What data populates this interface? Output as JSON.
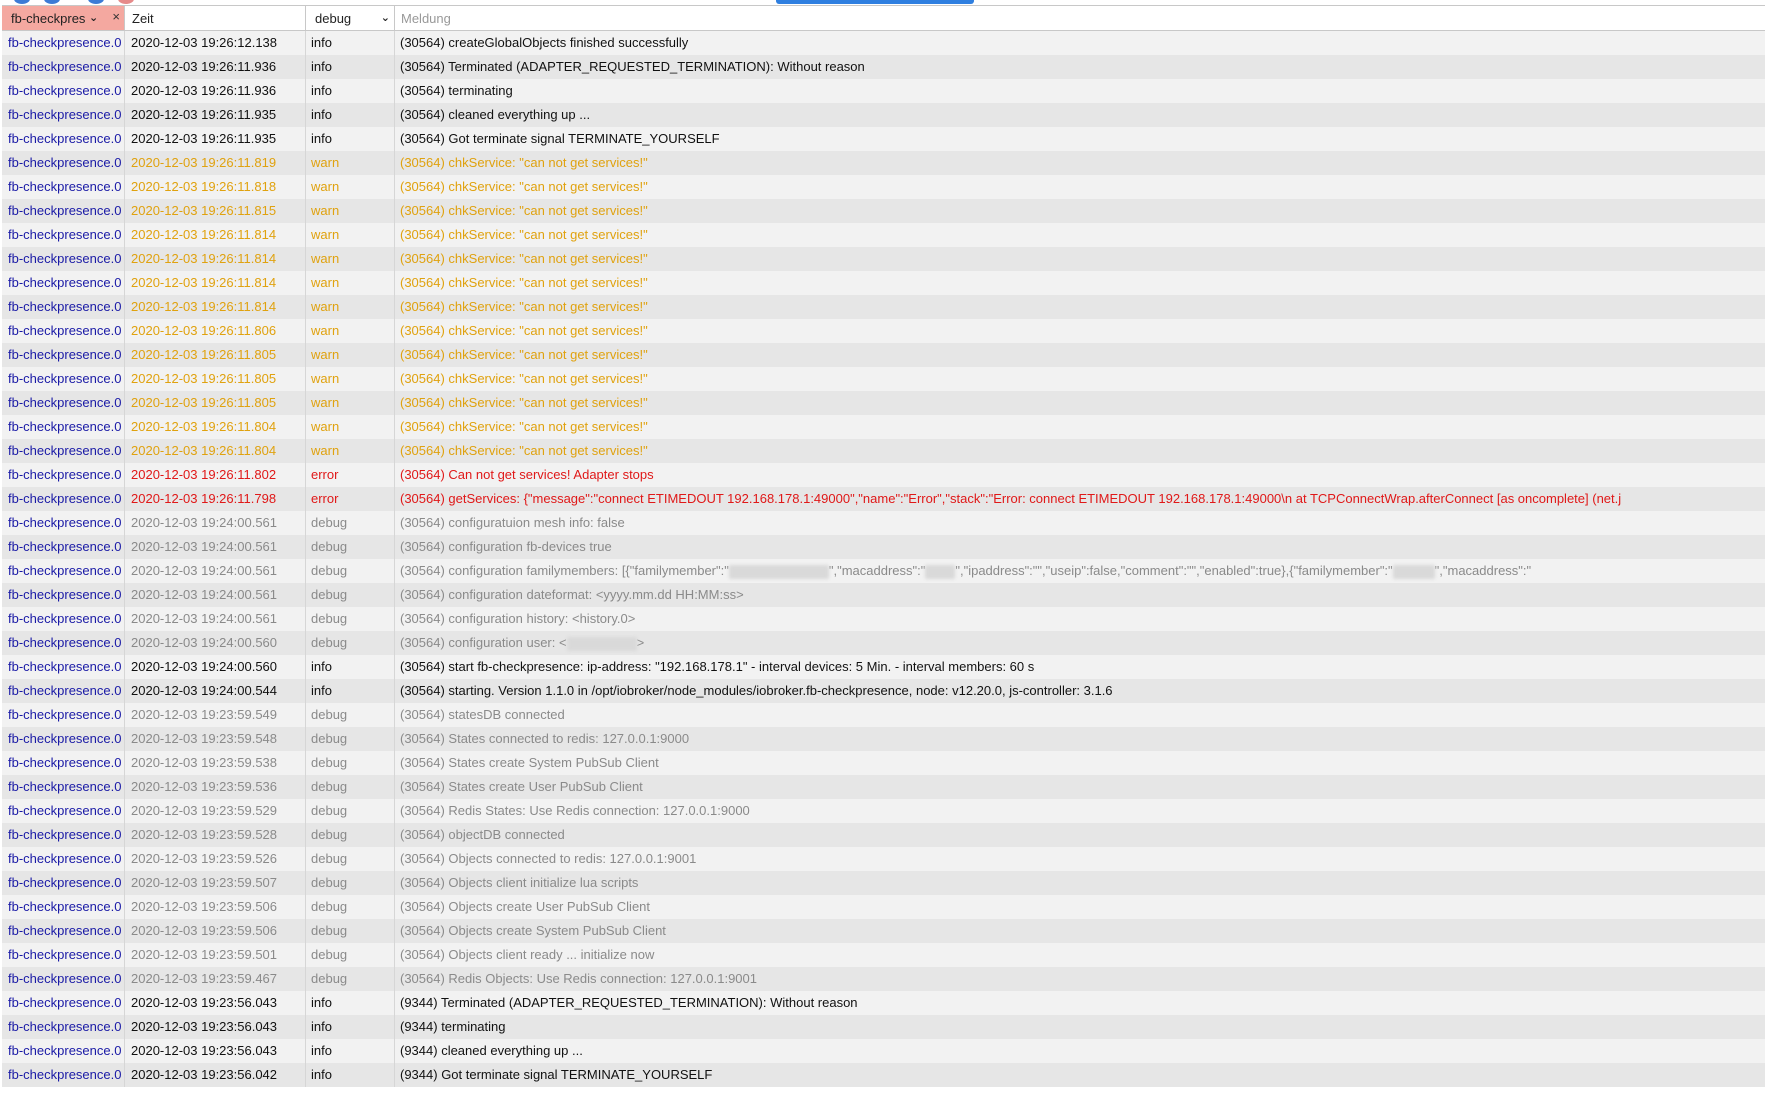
{
  "filter": {
    "source_value": "fb-checkpres",
    "clear_label": "×",
    "time_placeholder": "Zeit",
    "level_value": "debug",
    "message_placeholder": "Meldung"
  },
  "colors": {
    "info": "#111111",
    "warn": "#e0a20f",
    "error": "#e01818",
    "debug": "#8a8a8a",
    "source": "#1a1aa6",
    "source_filter_bg": "#f4a8a0"
  },
  "log": [
    {
      "source": "fb-checkpresence.0",
      "time": "2020-12-03 19:26:12.138",
      "level": "info",
      "message": "(30564) createGlobalObjects finished successfully"
    },
    {
      "source": "fb-checkpresence.0",
      "time": "2020-12-03 19:26:11.936",
      "level": "info",
      "message": "(30564) Terminated (ADAPTER_REQUESTED_TERMINATION): Without reason"
    },
    {
      "source": "fb-checkpresence.0",
      "time": "2020-12-03 19:26:11.936",
      "level": "info",
      "message": "(30564) terminating"
    },
    {
      "source": "fb-checkpresence.0",
      "time": "2020-12-03 19:26:11.935",
      "level": "info",
      "message": "(30564) cleaned everything up ..."
    },
    {
      "source": "fb-checkpresence.0",
      "time": "2020-12-03 19:26:11.935",
      "level": "info",
      "message": "(30564) Got terminate signal TERMINATE_YOURSELF"
    },
    {
      "source": "fb-checkpresence.0",
      "time": "2020-12-03 19:26:11.819",
      "level": "warn",
      "message": "(30564) chkService: \"can not get services!\""
    },
    {
      "source": "fb-checkpresence.0",
      "time": "2020-12-03 19:26:11.818",
      "level": "warn",
      "message": "(30564) chkService: \"can not get services!\""
    },
    {
      "source": "fb-checkpresence.0",
      "time": "2020-12-03 19:26:11.815",
      "level": "warn",
      "message": "(30564) chkService: \"can not get services!\""
    },
    {
      "source": "fb-checkpresence.0",
      "time": "2020-12-03 19:26:11.814",
      "level": "warn",
      "message": "(30564) chkService: \"can not get services!\""
    },
    {
      "source": "fb-checkpresence.0",
      "time": "2020-12-03 19:26:11.814",
      "level": "warn",
      "message": "(30564) chkService: \"can not get services!\""
    },
    {
      "source": "fb-checkpresence.0",
      "time": "2020-12-03 19:26:11.814",
      "level": "warn",
      "message": "(30564) chkService: \"can not get services!\""
    },
    {
      "source": "fb-checkpresence.0",
      "time": "2020-12-03 19:26:11.814",
      "level": "warn",
      "message": "(30564) chkService: \"can not get services!\""
    },
    {
      "source": "fb-checkpresence.0",
      "time": "2020-12-03 19:26:11.806",
      "level": "warn",
      "message": "(30564) chkService: \"can not get services!\""
    },
    {
      "source": "fb-checkpresence.0",
      "time": "2020-12-03 19:26:11.805",
      "level": "warn",
      "message": "(30564) chkService: \"can not get services!\""
    },
    {
      "source": "fb-checkpresence.0",
      "time": "2020-12-03 19:26:11.805",
      "level": "warn",
      "message": "(30564) chkService: \"can not get services!\""
    },
    {
      "source": "fb-checkpresence.0",
      "time": "2020-12-03 19:26:11.805",
      "level": "warn",
      "message": "(30564) chkService: \"can not get services!\""
    },
    {
      "source": "fb-checkpresence.0",
      "time": "2020-12-03 19:26:11.804",
      "level": "warn",
      "message": "(30564) chkService: \"can not get services!\""
    },
    {
      "source": "fb-checkpresence.0",
      "time": "2020-12-03 19:26:11.804",
      "level": "warn",
      "message": "(30564) chkService: \"can not get services!\""
    },
    {
      "source": "fb-checkpresence.0",
      "time": "2020-12-03 19:26:11.802",
      "level": "error",
      "message": "(30564) Can not get services! Adapter stops"
    },
    {
      "source": "fb-checkpresence.0",
      "time": "2020-12-03 19:26:11.798",
      "level": "error",
      "message": "(30564) getServices: {\"message\":\"connect ETIMEDOUT 192.168.178.1:49000\",\"name\":\"Error\",\"stack\":\"Error: connect ETIMEDOUT 192.168.178.1:49000\\n at TCPConnectWrap.afterConnect [as oncomplete] (net.j"
    },
    {
      "source": "fb-checkpresence.0",
      "time": "2020-12-03 19:24:00.561",
      "level": "debug",
      "message": "(30564) configuratuion mesh info: false"
    },
    {
      "source": "fb-checkpresence.0",
      "time": "2020-12-03 19:24:00.561",
      "level": "debug",
      "message": "(30564) configuration fb-devices true"
    },
    {
      "source": "fb-checkpresence.0",
      "time": "2020-12-03 19:24:00.561",
      "level": "debug",
      "message": "",
      "parts": [
        "(30564) configuration familymembers: [{\"familymember\":\"",
        "\",\"macaddress\":\"",
        "\",\"ipaddress\":\"\",\"useip\":false,\"comment\":\"\",\"enabled\":true},{\"familymember\":\"",
        "\",\"macaddress\":\""
      ]
    },
    {
      "source": "fb-checkpresence.0",
      "time": "2020-12-03 19:24:00.561",
      "level": "debug",
      "message": "(30564) configuration dateformat: <yyyy.mm.dd HH:MM:ss>"
    },
    {
      "source": "fb-checkpresence.0",
      "time": "2020-12-03 19:24:00.561",
      "level": "debug",
      "message": "(30564) configuration history: <history.0>"
    },
    {
      "source": "fb-checkpresence.0",
      "time": "2020-12-03 19:24:00.560",
      "level": "debug",
      "message": "",
      "parts": [
        "(30564) configuration user: <",
        ">"
      ]
    },
    {
      "source": "fb-checkpresence.0",
      "time": "2020-12-03 19:24:00.560",
      "level": "info",
      "message": "(30564) start fb-checkpresence: ip-address: \"192.168.178.1\" - interval devices: 5 Min. - interval members: 60 s"
    },
    {
      "source": "fb-checkpresence.0",
      "time": "2020-12-03 19:24:00.544",
      "level": "info",
      "message": "(30564) starting. Version 1.1.0 in /opt/iobroker/node_modules/iobroker.fb-checkpresence, node: v12.20.0, js-controller: 3.1.6"
    },
    {
      "source": "fb-checkpresence.0",
      "time": "2020-12-03 19:23:59.549",
      "level": "debug",
      "message": "(30564) statesDB connected"
    },
    {
      "source": "fb-checkpresence.0",
      "time": "2020-12-03 19:23:59.548",
      "level": "debug",
      "message": "(30564) States connected to redis: 127.0.0.1:9000"
    },
    {
      "source": "fb-checkpresence.0",
      "time": "2020-12-03 19:23:59.538",
      "level": "debug",
      "message": "(30564) States create System PubSub Client"
    },
    {
      "source": "fb-checkpresence.0",
      "time": "2020-12-03 19:23:59.536",
      "level": "debug",
      "message": "(30564) States create User PubSub Client"
    },
    {
      "source": "fb-checkpresence.0",
      "time": "2020-12-03 19:23:59.529",
      "level": "debug",
      "message": "(30564) Redis States: Use Redis connection: 127.0.0.1:9000"
    },
    {
      "source": "fb-checkpresence.0",
      "time": "2020-12-03 19:23:59.528",
      "level": "debug",
      "message": "(30564) objectDB connected"
    },
    {
      "source": "fb-checkpresence.0",
      "time": "2020-12-03 19:23:59.526",
      "level": "debug",
      "message": "(30564) Objects connected to redis: 127.0.0.1:9001"
    },
    {
      "source": "fb-checkpresence.0",
      "time": "2020-12-03 19:23:59.507",
      "level": "debug",
      "message": "(30564) Objects client initialize lua scripts"
    },
    {
      "source": "fb-checkpresence.0",
      "time": "2020-12-03 19:23:59.506",
      "level": "debug",
      "message": "(30564) Objects create User PubSub Client"
    },
    {
      "source": "fb-checkpresence.0",
      "time": "2020-12-03 19:23:59.506",
      "level": "debug",
      "message": "(30564) Objects create System PubSub Client"
    },
    {
      "source": "fb-checkpresence.0",
      "time": "2020-12-03 19:23:59.501",
      "level": "debug",
      "message": "(30564) Objects client ready ... initialize now"
    },
    {
      "source": "fb-checkpresence.0",
      "time": "2020-12-03 19:23:59.467",
      "level": "debug",
      "message": "(30564) Redis Objects: Use Redis connection: 127.0.0.1:9001"
    },
    {
      "source": "fb-checkpresence.0",
      "time": "2020-12-03 19:23:56.043",
      "level": "info",
      "message": "(9344) Terminated (ADAPTER_REQUESTED_TERMINATION): Without reason"
    },
    {
      "source": "fb-checkpresence.0",
      "time": "2020-12-03 19:23:56.043",
      "level": "info",
      "message": "(9344) terminating"
    },
    {
      "source": "fb-checkpresence.0",
      "time": "2020-12-03 19:23:56.043",
      "level": "info",
      "message": "(9344) cleaned everything up ..."
    },
    {
      "source": "fb-checkpresence.0",
      "time": "2020-12-03 19:23:56.042",
      "level": "info",
      "message": "(9344) Got terminate signal TERMINATE_YOURSELF"
    }
  ]
}
